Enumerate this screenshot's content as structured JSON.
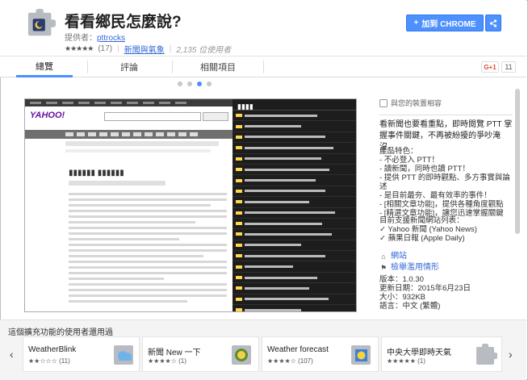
{
  "header": {
    "title": "看看鄉民怎麼說?",
    "provider_label": "提供者：",
    "provider_name": "pttrocks",
    "stars": "★★★★★",
    "rating_count": "(17)",
    "category": "新聞與氣象",
    "users": "2,135 位使用者",
    "add_button": "加到 CHROME",
    "share_icon": "share-icon"
  },
  "tabs": [
    {
      "label": "總覽"
    },
    {
      "label": "評論"
    },
    {
      "label": "相關項目"
    }
  ],
  "gplus": {
    "label": "G+1",
    "count": "11"
  },
  "sidebar": {
    "compat": "與您的裝置相容",
    "description": "看新聞也要看重點，即時閱覽 PTT 掌握事件關鍵，不再被紛擾的爭吵淹沒。",
    "features_title": "產品特色：",
    "features": [
      "- 不必登入 PTT！",
      "- 讀新聞，同時也讀 PTT！",
      "- 提供 PTT 的即時觀點、多方事實與論述",
      "- 是目前最夯、最有效率的事件！",
      "- [相關文章功能]，提供各種角度觀點",
      "- [精選文章功能]，讓您迅速掌握關鍵"
    ],
    "sites_title": "目前支援新聞網站列表：",
    "sites": [
      "✓ Yahoo 新聞 (Yahoo News)",
      "✓ 蘋果日報 (Apple Daily)"
    ],
    "link_website": "網站",
    "link_report": "檢舉濫用情形",
    "version": "版本：1.0.30",
    "updated": "更新日期：2015年6月23日",
    "size": "大小：932KB",
    "language": "語言：中文 (繁體)"
  },
  "bottom": {
    "title": "這個擴充功能的使用者還用過",
    "prev_icon": "chevron-left-icon",
    "next_icon": "chevron-right-icon",
    "items": [
      {
        "name": "WeatherBlink",
        "stars": "★★☆☆☆",
        "count": "(11)"
      },
      {
        "name": "新聞 New 一下",
        "stars": "★★★★☆",
        "count": "(1)"
      },
      {
        "name": "Weather forecast",
        "stars": "★★★★☆",
        "count": "(107)"
      },
      {
        "name": "中央大學即時天氣",
        "stars": "★★★★★",
        "count": "(1)"
      }
    ]
  },
  "colors": {
    "accent": "#4d90fe",
    "link": "#3367d6",
    "panel_dark": "#1d1d1d"
  }
}
